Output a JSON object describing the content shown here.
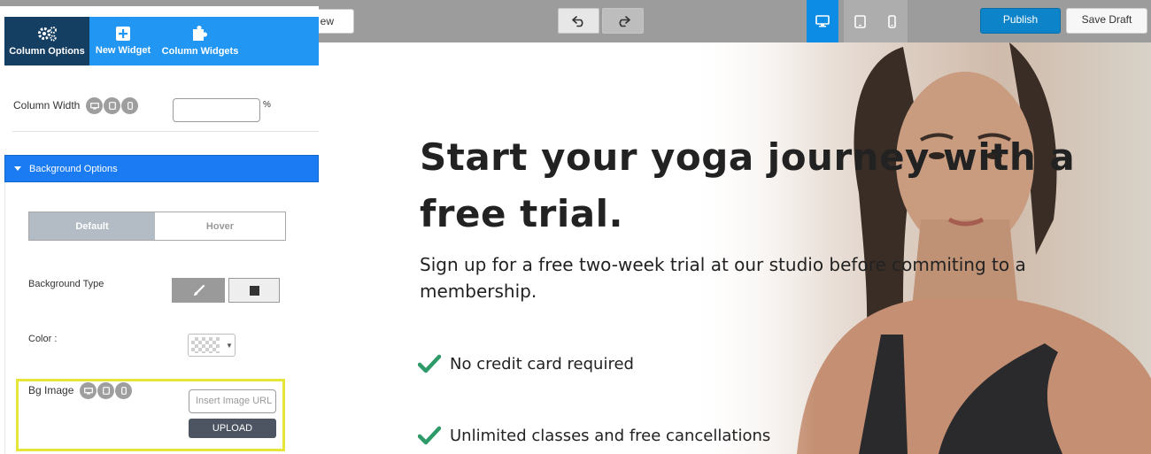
{
  "toolbar": {
    "preview_label": "ew",
    "publish_label": "Publish",
    "save_draft_label": "Save Draft",
    "undo_icon": "undo-icon",
    "redo_icon": "redo-icon",
    "devices": [
      "desktop",
      "tablet",
      "mobile"
    ],
    "active_device": "desktop",
    "accent_color": "#0d8ce6"
  },
  "panel": {
    "tabs": [
      {
        "label": "Column Options",
        "icon": "gears-icon",
        "active": true
      },
      {
        "label": "New Widget",
        "icon": "plus-square-icon",
        "active": false
      },
      {
        "label": "Column Widgets",
        "icon": "puzzle-icon",
        "active": false
      }
    ],
    "column_width_label": "Column Width",
    "column_width_value": "",
    "column_width_unit": "%",
    "section_title": "Background Options",
    "state_tabs": {
      "default_label": "Default",
      "hover_label": "Hover",
      "active": "Default"
    },
    "background_type_label": "Background Type",
    "background_type_options": [
      "brush-icon",
      "square-icon"
    ],
    "background_type_active": "brush-icon",
    "color_label": "Color :",
    "color_value": "transparent",
    "bg_image_label": "Bg Image",
    "bg_image_placeholder": "Insert Image URL",
    "upload_label": "UPLOAD",
    "highlight_color": "#e6e63a"
  },
  "hero": {
    "title": "Start your yoga journey with a free trial.",
    "subtitle": "Sign up for a free two-week trial at our studio before commiting to a membership.",
    "features": [
      "No credit card required",
      "Unlimited classes and free cancellations"
    ],
    "check_color": "#2e9a6a"
  }
}
